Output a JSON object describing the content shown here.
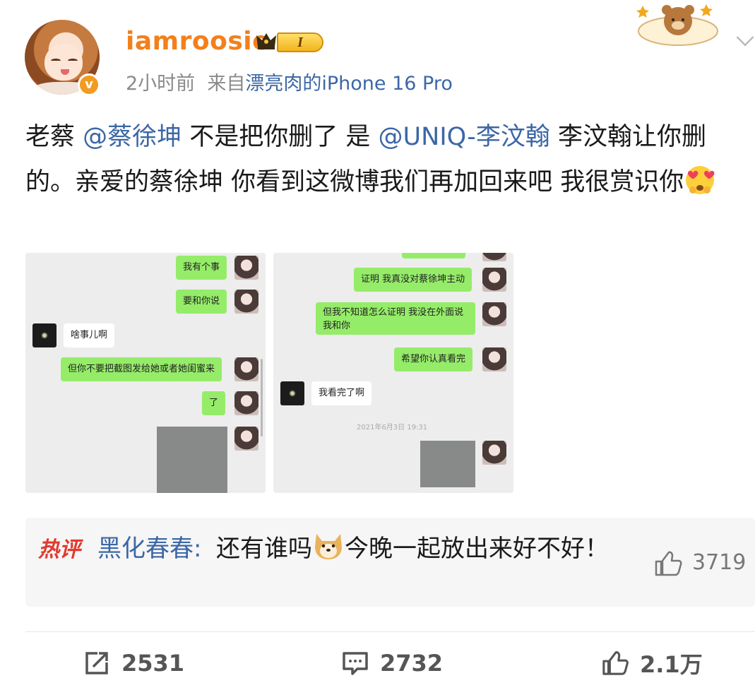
{
  "header": {
    "username": "iamroosie",
    "level_label": "I",
    "time": "2小时前",
    "source_prefix": "来自",
    "source": "漂亮肉的iPhone 16 Pro"
  },
  "post": {
    "t1": "老蔡 ",
    "mention1": "@蔡徐坤",
    "t2": " 不是把你删了 是 ",
    "mention2": "@UNIQ-李汶翰",
    "t3": " 李汶翰让你删的。亲爱的蔡徐坤 你看到这微博我们再加回来吧 我很赏识你"
  },
  "screenshot1": {
    "messages": [
      "我有个事",
      "要和你说",
      "啥事儿啊",
      "但你不要把截图发给她或者她闺蜜来",
      "了"
    ]
  },
  "screenshot2": {
    "messages": [
      "证明 我真没对蔡徐坤主动",
      "但我不知道怎么证明 我没在外面说我和你",
      "希望你认真看完",
      "我看完了啊"
    ],
    "timestamp": "2021年6月3日 19:31"
  },
  "hot_comment": {
    "tag": "热评",
    "user": "黑化春春:",
    "text_before": "还有谁吗",
    "text_after": "今晚一起放出来好不好！",
    "likes": "3719"
  },
  "actions": {
    "reposts": "2531",
    "comments": "2732",
    "likes": "2.1万"
  },
  "colors": {
    "username": "#f2801b",
    "link": "#3c67a6",
    "hot_tag": "#e23a2e",
    "chat_green": "#95ec69"
  },
  "icons": [
    "crown-icon",
    "verified-badge-icon",
    "chevron-down-icon",
    "heart-eyes-emoji-icon",
    "doge-emoji-icon",
    "thumbs-up-icon",
    "repost-icon",
    "comment-icon"
  ]
}
